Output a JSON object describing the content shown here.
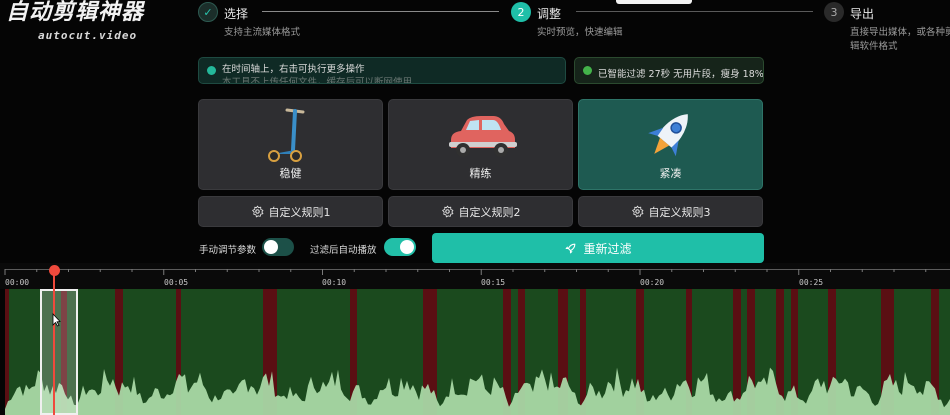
{
  "brand": {
    "name": "自动剪辑神器",
    "domain": "autocut.video"
  },
  "steps": [
    {
      "index": "✓",
      "title": "选择",
      "desc": "支持主流媒体格式",
      "state": "done"
    },
    {
      "index": "2",
      "title": "调整",
      "desc": "实时预览，快速编辑",
      "state": "active"
    },
    {
      "index": "3",
      "title": "导出",
      "desc": "直接导出媒体，或各种剪辑软件格式",
      "state": "pending"
    }
  ],
  "notices": {
    "info_line1": "在时间轴上，右击可执行更多操作",
    "info_line2": "本工具不上传任何文件，缓存后可以断网使用",
    "status": "已智能过滤 27秒 无用片段，瘦身 18%"
  },
  "presets": [
    {
      "label": "稳健",
      "icon": "scooter-icon",
      "active": false
    },
    {
      "label": "精练",
      "icon": "car-icon",
      "active": false
    },
    {
      "label": "紧凑",
      "icon": "rocket-icon",
      "active": true
    }
  ],
  "rules": [
    {
      "label": "自定义规则1",
      "icon": "gear-icon"
    },
    {
      "label": "自定义规则2",
      "icon": "gear-icon"
    },
    {
      "label": "自定义规则3",
      "icon": "gear-icon"
    }
  ],
  "toggles": {
    "manual_label": "手动调节参数",
    "manual_on": false,
    "autoplay_label": "过滤后自动播放",
    "autoplay_on": true
  },
  "refilter_label": "重新过滤",
  "timeline": {
    "ticks": [
      "00:00",
      "00:05",
      "00:10",
      "00:15",
      "00:20",
      "00:25"
    ],
    "colors": {
      "keep": "#1b4a1e",
      "cut": "#5a0f13",
      "wave": "#a9d8a5",
      "accent": "#1fbfa8",
      "playhead": "#ef4a3c"
    }
  }
}
